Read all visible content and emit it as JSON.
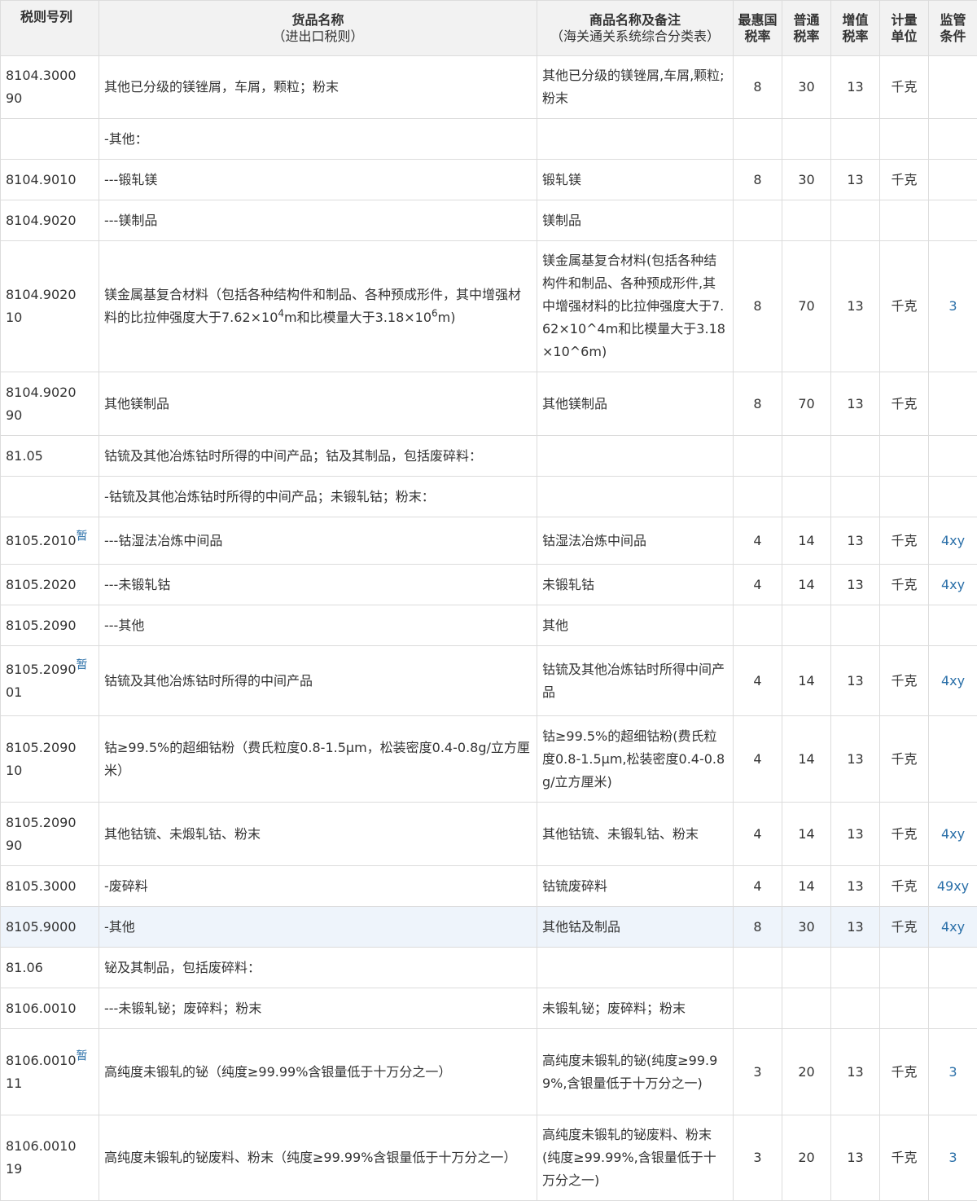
{
  "headers": {
    "code": "税则号列",
    "name": "货品名称",
    "name_sub": "（进出口税则）",
    "remark": "商品名称及备注",
    "remark_sub": "（海关通关系统综合分类表）",
    "mfn_line1": "最惠国",
    "mfn_line2": "税率",
    "general_line1": "普通",
    "general_line2": "税率",
    "vat_line1": "增值",
    "vat_line2": "税率",
    "unit_line1": "计量",
    "unit_line2": "单位",
    "sup_line1": "监管",
    "sup_line2": "条件"
  },
  "rows": [
    {
      "code": "8104.3000",
      "code2": "90",
      "tag": "",
      "name": "其他已分级的镁锉屑，车屑，颗粒；粉末",
      "remark": "其他已分级的镁锉屑,车屑,颗粒;粉末",
      "mfn": "8",
      "general": "30",
      "vat": "13",
      "unit": "千克",
      "sup": ""
    },
    {
      "code": "",
      "code2": "",
      "tag": "",
      "name": "-其他：",
      "remark": "",
      "mfn": "",
      "general": "",
      "vat": "",
      "unit": "",
      "sup": ""
    },
    {
      "code": "8104.9010",
      "code2": "",
      "tag": "",
      "name": "---锻轧镁",
      "remark": "锻轧镁",
      "mfn": "8",
      "general": "30",
      "vat": "13",
      "unit": "千克",
      "sup": ""
    },
    {
      "code": "8104.9020",
      "code2": "",
      "tag": "",
      "name": "---镁制品",
      "remark": "镁制品",
      "mfn": "",
      "general": "",
      "vat": "",
      "unit": "",
      "sup": ""
    },
    {
      "code": "8104.9020",
      "code2": "10",
      "tag": "",
      "name": "镁金属基复合材料（包括各种结构件和制品、各种预成形件，其中增强材料的比拉伸强度大于7.62×10",
      "name_exp1": "4",
      "name_mid": "m和比模量大于3.18×10",
      "name_exp2": "6",
      "name_end": "m)",
      "remark": "镁金属基复合材料(包括各种结构件和制品、各种预成形件,其中增强材料的比拉伸强度大于7.62×10^4m和比模量大于3.18×10^6m)",
      "mfn": "8",
      "general": "70",
      "vat": "13",
      "unit": "千克",
      "sup": "3"
    },
    {
      "code": "8104.9020",
      "code2": "90",
      "tag": "",
      "name": "其他镁制品",
      "remark": "其他镁制品",
      "mfn": "8",
      "general": "70",
      "vat": "13",
      "unit": "千克",
      "sup": ""
    },
    {
      "code": "81.05",
      "code2": "",
      "tag": "",
      "name": "钴锍及其他冶炼钴时所得的中间产品；钴及其制品，包括废碎料：",
      "remark": "",
      "mfn": "",
      "general": "",
      "vat": "",
      "unit": "",
      "sup": ""
    },
    {
      "code": "",
      "code2": "",
      "tag": "",
      "name": "-钴锍及其他冶炼钴时所得的中间产品；未锻轧钴；粉末：",
      "remark": "",
      "mfn": "",
      "general": "",
      "vat": "",
      "unit": "",
      "sup": ""
    },
    {
      "code": "8105.2010",
      "code2": "",
      "tag": "暂",
      "name": "---钴湿法冶炼中间品",
      "remark": "钴湿法冶炼中间品",
      "mfn": "4",
      "general": "14",
      "vat": "13",
      "unit": "千克",
      "sup": "4xy"
    },
    {
      "code": "8105.2020",
      "code2": "",
      "tag": "",
      "name": "---未锻轧钴",
      "remark": "未锻轧钴",
      "mfn": "4",
      "general": "14",
      "vat": "13",
      "unit": "千克",
      "sup": "4xy"
    },
    {
      "code": "8105.2090",
      "code2": "",
      "tag": "",
      "name": "---其他",
      "remark": "其他",
      "mfn": "",
      "general": "",
      "vat": "",
      "unit": "",
      "sup": ""
    },
    {
      "code": "8105.2090",
      "code2": "01",
      "tag": "暂",
      "name": "钴锍及其他冶炼钴时所得的中间产品",
      "remark": "钴锍及其他冶炼钴时所得中间产品",
      "mfn": "4",
      "general": "14",
      "vat": "13",
      "unit": "千克",
      "sup": "4xy"
    },
    {
      "code": "8105.2090",
      "code2": "10",
      "tag": "",
      "name": "钴≥99.5%的超细钴粉（费氏粒度0.8-1.5μm，松装密度0.4-0.8g/立方厘米）",
      "remark": "钴≥99.5%的超细钴粉(费氏粒度0.8-1.5μm,松装密度0.4-0.8g/立方厘米)",
      "mfn": "4",
      "general": "14",
      "vat": "13",
      "unit": "千克",
      "sup": ""
    },
    {
      "code": "8105.2090",
      "code2": "90",
      "tag": "",
      "name": "其他钴锍、未煅轧钴、粉末",
      "remark": "其他钴锍、未锻轧钴、粉末",
      "mfn": "4",
      "general": "14",
      "vat": "13",
      "unit": "千克",
      "sup": "4xy"
    },
    {
      "code": "8105.3000",
      "code2": "",
      "tag": "",
      "name": "-废碎料",
      "remark": "钴锍废碎料",
      "mfn": "4",
      "general": "14",
      "vat": "13",
      "unit": "千克",
      "sup": "49xy"
    },
    {
      "code": "8105.9000",
      "code2": "",
      "tag": "",
      "name": "-其他",
      "remark": "其他钴及制品",
      "mfn": "8",
      "general": "30",
      "vat": "13",
      "unit": "千克",
      "sup": "4xy"
    },
    {
      "code": "81.06",
      "code2": "",
      "tag": "",
      "name": "铋及其制品，包括废碎料：",
      "remark": "",
      "mfn": "",
      "general": "",
      "vat": "",
      "unit": "",
      "sup": ""
    },
    {
      "code": "8106.0010",
      "code2": "",
      "tag": "",
      "name": "---未锻轧铋；废碎料；粉末",
      "remark": "未锻轧铋；废碎料；粉末",
      "mfn": "",
      "general": "",
      "vat": "",
      "unit": "",
      "sup": ""
    },
    {
      "code": "8106.0010",
      "code2": "11",
      "tag": "暂",
      "name": "高纯度未锻轧的铋（纯度≥99.99%含银量低于十万分之一）",
      "remark": "高纯度未锻轧的铋(纯度≥99.99%,含银量低于十万分之一)",
      "mfn": "3",
      "general": "20",
      "vat": "13",
      "unit": "千克",
      "sup": "3"
    },
    {
      "code": "8106.0010",
      "code2": "19",
      "tag": "",
      "name": "高纯度未锻轧的铋废料、粉末（纯度≥99.99%含银量低于十万分之一）",
      "remark": "高纯度未锻轧的铋废料、粉末(纯度≥99.99%,含银量低于十万分之一)",
      "mfn": "3",
      "general": "20",
      "vat": "13",
      "unit": "千克",
      "sup": "3"
    }
  ]
}
